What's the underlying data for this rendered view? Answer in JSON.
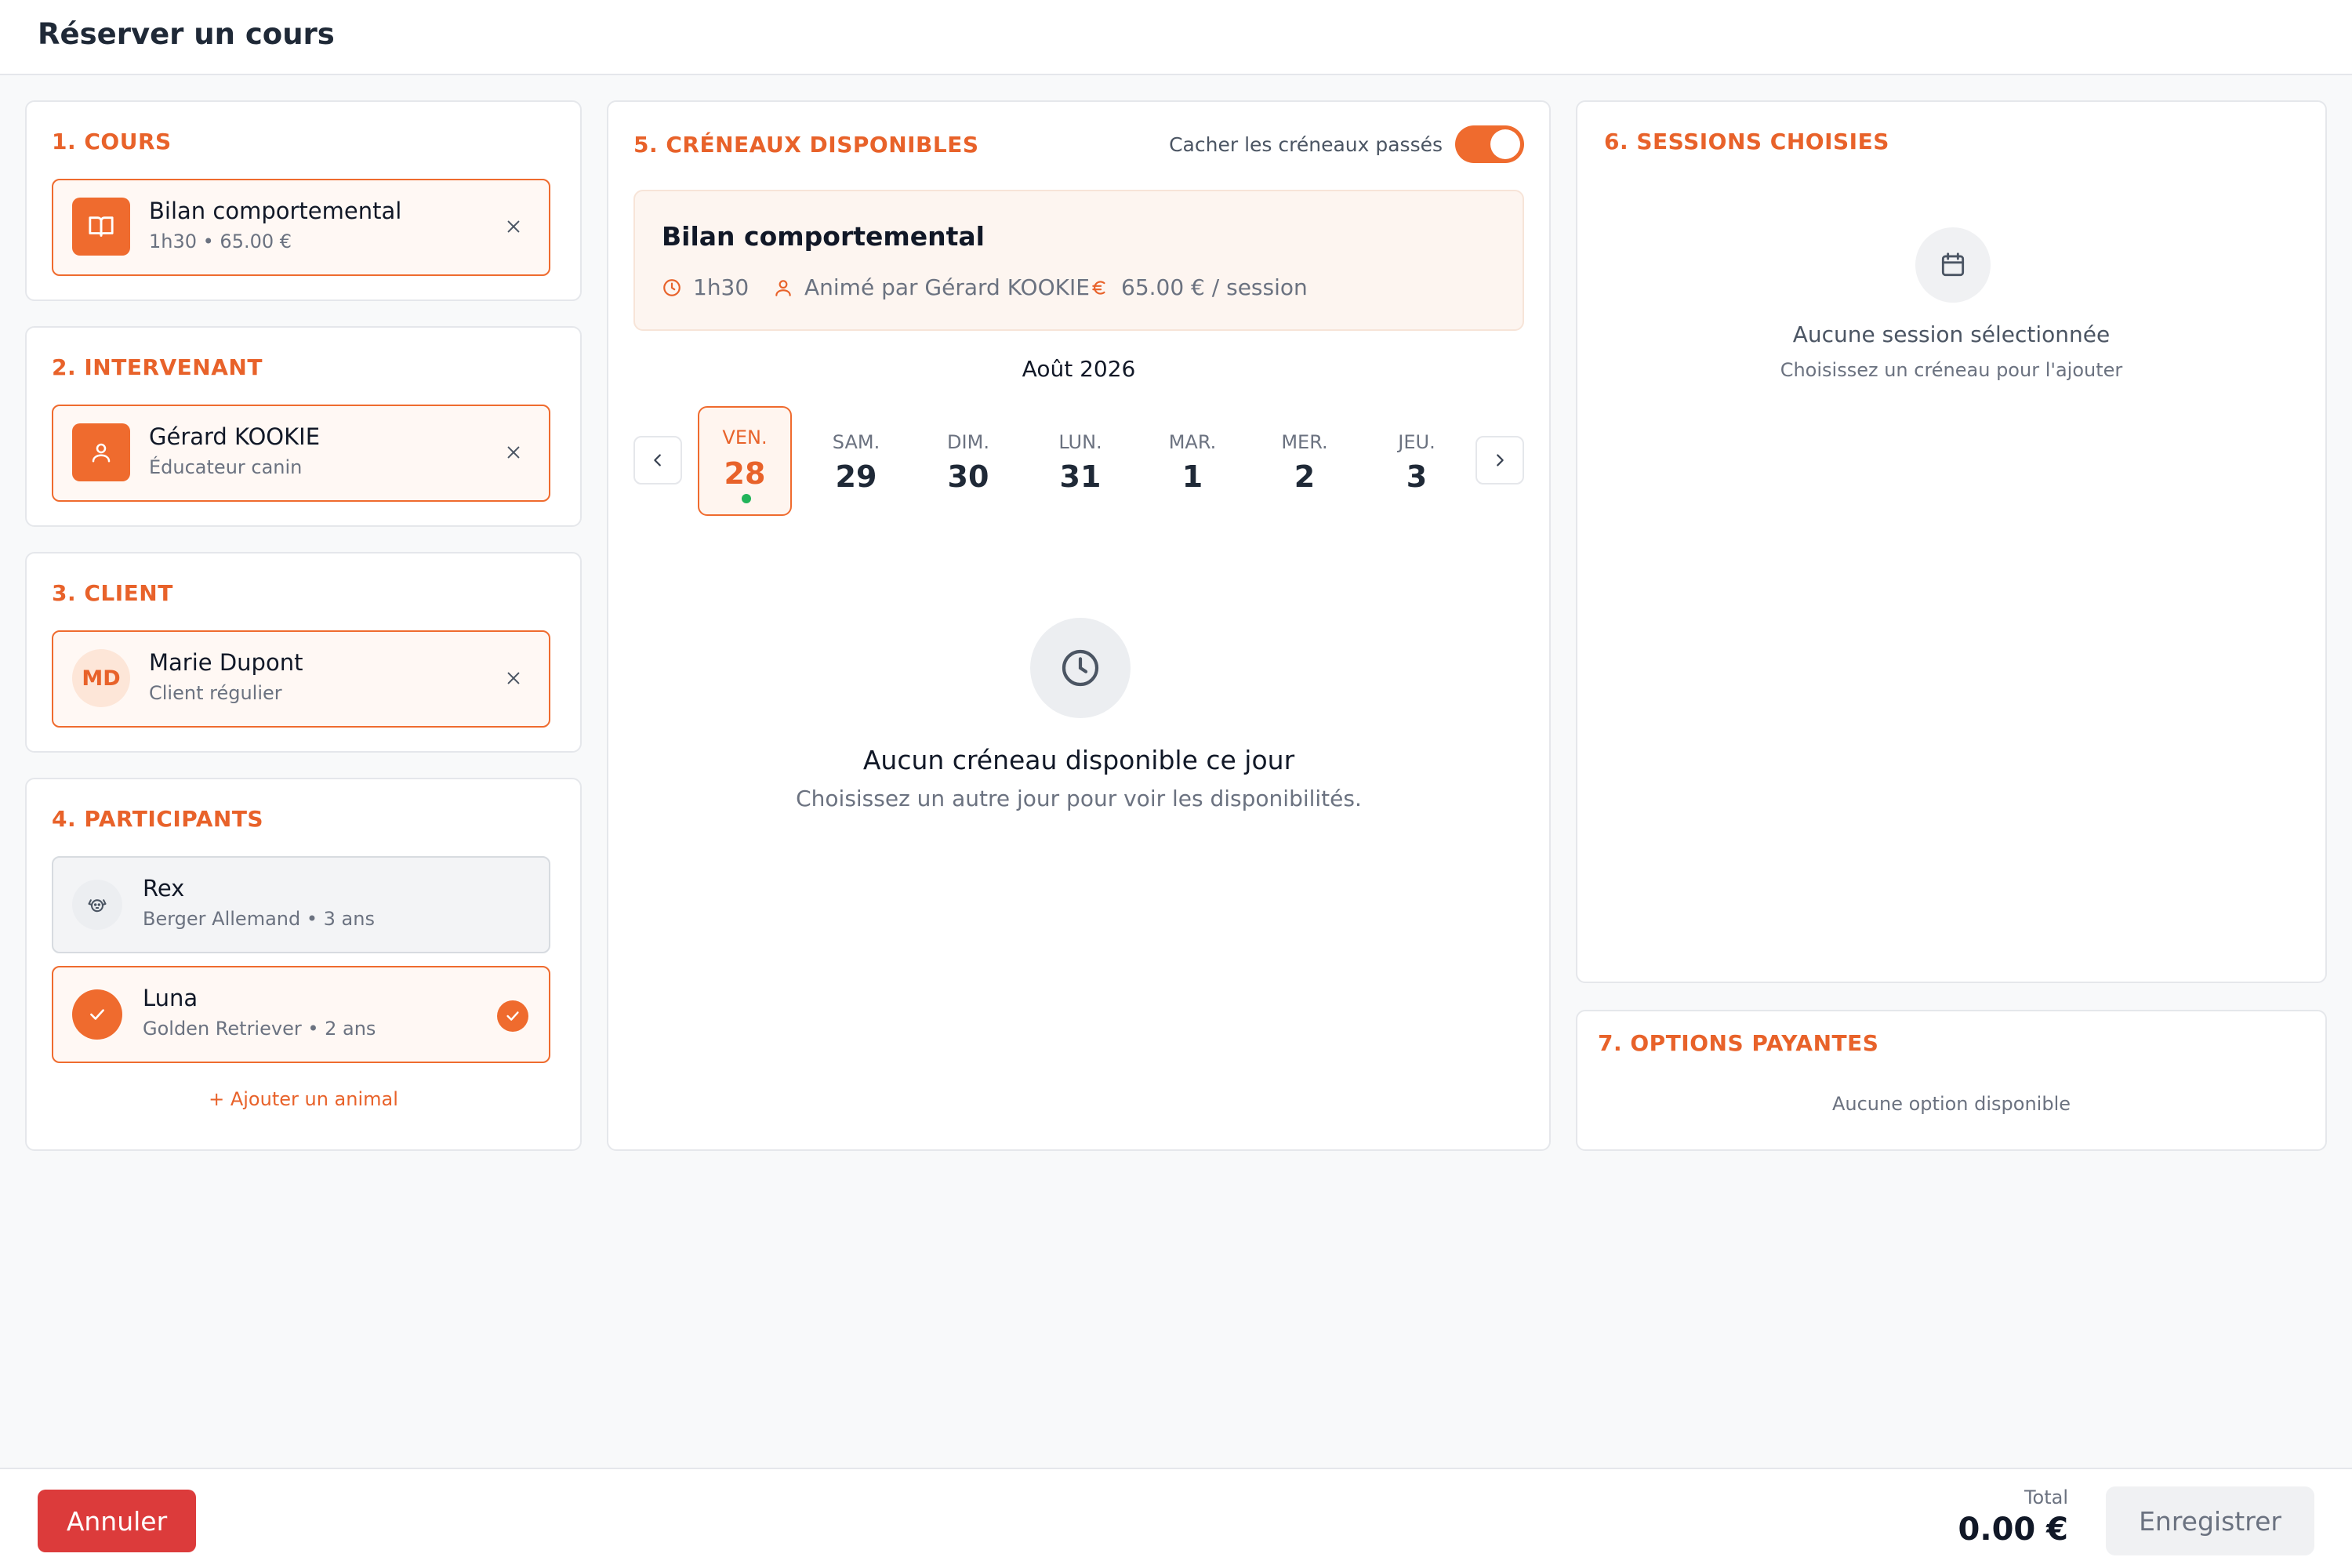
{
  "header": {
    "title": "Réserver un cours"
  },
  "cours": {
    "title": "1. COURS",
    "name": "Bilan comportemental",
    "sub": "1h30 • 65.00 €",
    "icon": "book-icon"
  },
  "intervenant": {
    "title": "2. INTERVENANT",
    "name": "Gérard KOOKIE",
    "sub": "Éducateur canin",
    "icon": "user-icon"
  },
  "client": {
    "title": "3. CLIENT",
    "initials": "MD",
    "name": "Marie Dupont",
    "sub": "Client régulier"
  },
  "participants": {
    "title": "4. PARTICIPANTS",
    "items": [
      {
        "name": "Rex",
        "sub": "Berger Allemand • 3 ans",
        "selected": false,
        "icon": "dog-icon"
      },
      {
        "name": "Luna",
        "sub": "Golden Retriever • 2 ans",
        "selected": true,
        "icon": "check-icon"
      }
    ],
    "add_label": "+ Ajouter un animal"
  },
  "creneaux": {
    "title": "5. CRÉNEAUX DISPONIBLES",
    "toggle_label": "Cacher les créneaux passés",
    "toggle_on": true,
    "course": {
      "name": "Bilan comportemental",
      "duration": "1h30",
      "animator": "Animé par Gérard KOOKIE",
      "price": "65.00 € / session"
    },
    "month": "Août 2026",
    "days": [
      {
        "name": "VEN.",
        "num": "28",
        "active": true,
        "available": true
      },
      {
        "name": "SAM.",
        "num": "29",
        "active": false
      },
      {
        "name": "DIM.",
        "num": "30",
        "active": false
      },
      {
        "name": "LUN.",
        "num": "31",
        "active": false
      },
      {
        "name": "MAR.",
        "num": "1",
        "active": false
      },
      {
        "name": "MER.",
        "num": "2",
        "active": false
      },
      {
        "name": "JEU.",
        "num": "3",
        "active": false
      }
    ],
    "empty_title": "Aucun créneau disponible ce jour",
    "empty_sub": "Choisissez un autre jour pour voir les disponibilités."
  },
  "sessions": {
    "title": "6. SESSIONS CHOISIES",
    "empty_title": "Aucune session sélectionnée",
    "empty_sub": "Choisissez un créneau pour l'ajouter"
  },
  "options": {
    "title": "7. OPTIONS PAYANTES",
    "empty": "Aucune option disponible"
  },
  "footer": {
    "cancel_label": "Annuler",
    "total_label": "Total",
    "total_value": "0.00 €",
    "save_label": "Enregistrer"
  },
  "colors": {
    "accent": "#ef6b2e",
    "danger": "#dc3b3b",
    "available_dot": "#22b45a"
  }
}
